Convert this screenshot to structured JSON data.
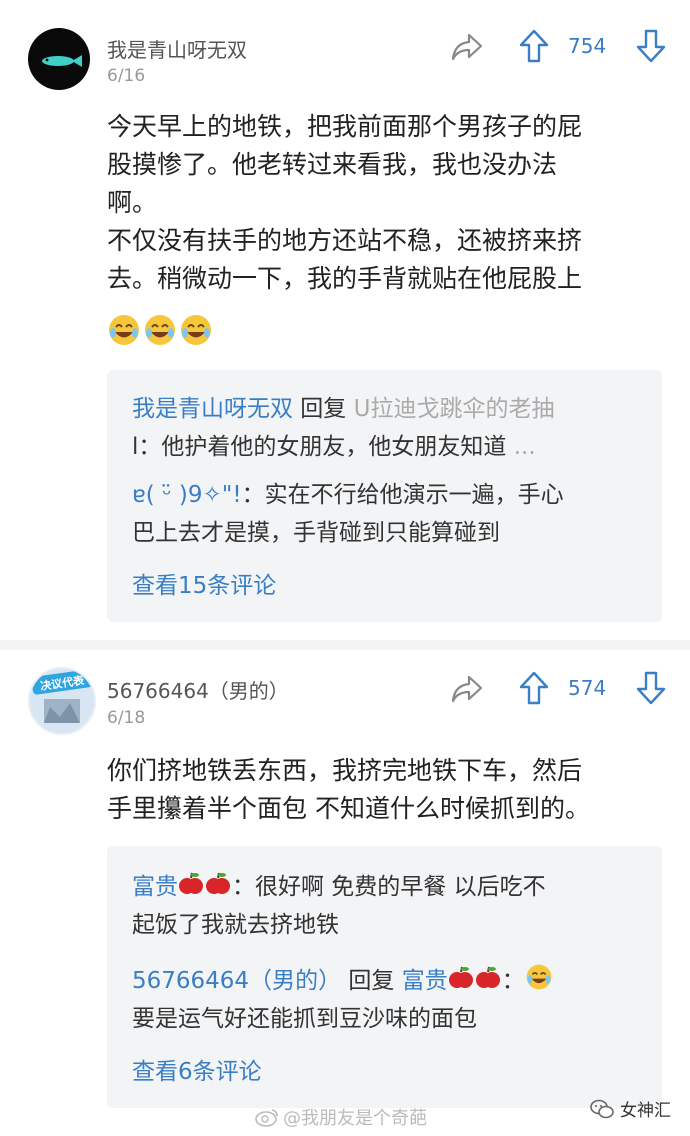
{
  "posts": [
    {
      "username": "我是青山呀无双",
      "date": "6/16",
      "vote_count": "754",
      "avatar_icon": "fish-icon",
      "body_lines": [
        "今天早上的地铁，把我前面那个男孩子的屁",
        "股摸惨了。他老转过来看我，我也没办法",
        "啊。",
        "不仅没有扶手的地方还站不稳，还被挤来挤",
        "去。稍微动一下，我的手背就贴在他屁股上"
      ],
      "emoji_count": 3,
      "replies": [
        {
          "name": "我是青山呀无双",
          "reply_word": " 回复 ",
          "target": "U拉迪戈跳伞的老抽",
          "line1_rest": "",
          "line2": "l：他护着他的女朋友，他女朋友知道",
          "line2_tail": " ..."
        },
        {
          "name": "ɐ( ᵕ̈ )9✧\"!",
          "text1": "：实在不行给他演示一遍，手心",
          "text2": "巴上去才是摸，手背碰到只能算碰到"
        }
      ],
      "more_label": "查看15条评论"
    },
    {
      "username": "56766464（男的）",
      "date": "6/18",
      "vote_count": "574",
      "avatar_badge": "决议代表",
      "body_lines": [
        "你们挤地铁丢东西，我挤完地铁下车，然后",
        "手里攥着半个面包 不知道什么时候抓到的。"
      ],
      "replies": [
        {
          "name": "富贵",
          "text1": "：很好啊 免费的早餐 以后吃不",
          "text2": "起饭了我就去挤地铁"
        },
        {
          "name": "56766464（男的）",
          "reply_word": " 回复 ",
          "target": "富贵",
          "text1": "：",
          "text2": "要是运气好还能抓到豆沙味的面包"
        }
      ],
      "more_label": "查看6条评论"
    }
  ],
  "footer": {
    "watermark": "@我朋友是个奇葩",
    "brand": "女神汇"
  },
  "colors": {
    "accent": "#3a7ec6",
    "reply_bg": "#f3f4f6"
  }
}
